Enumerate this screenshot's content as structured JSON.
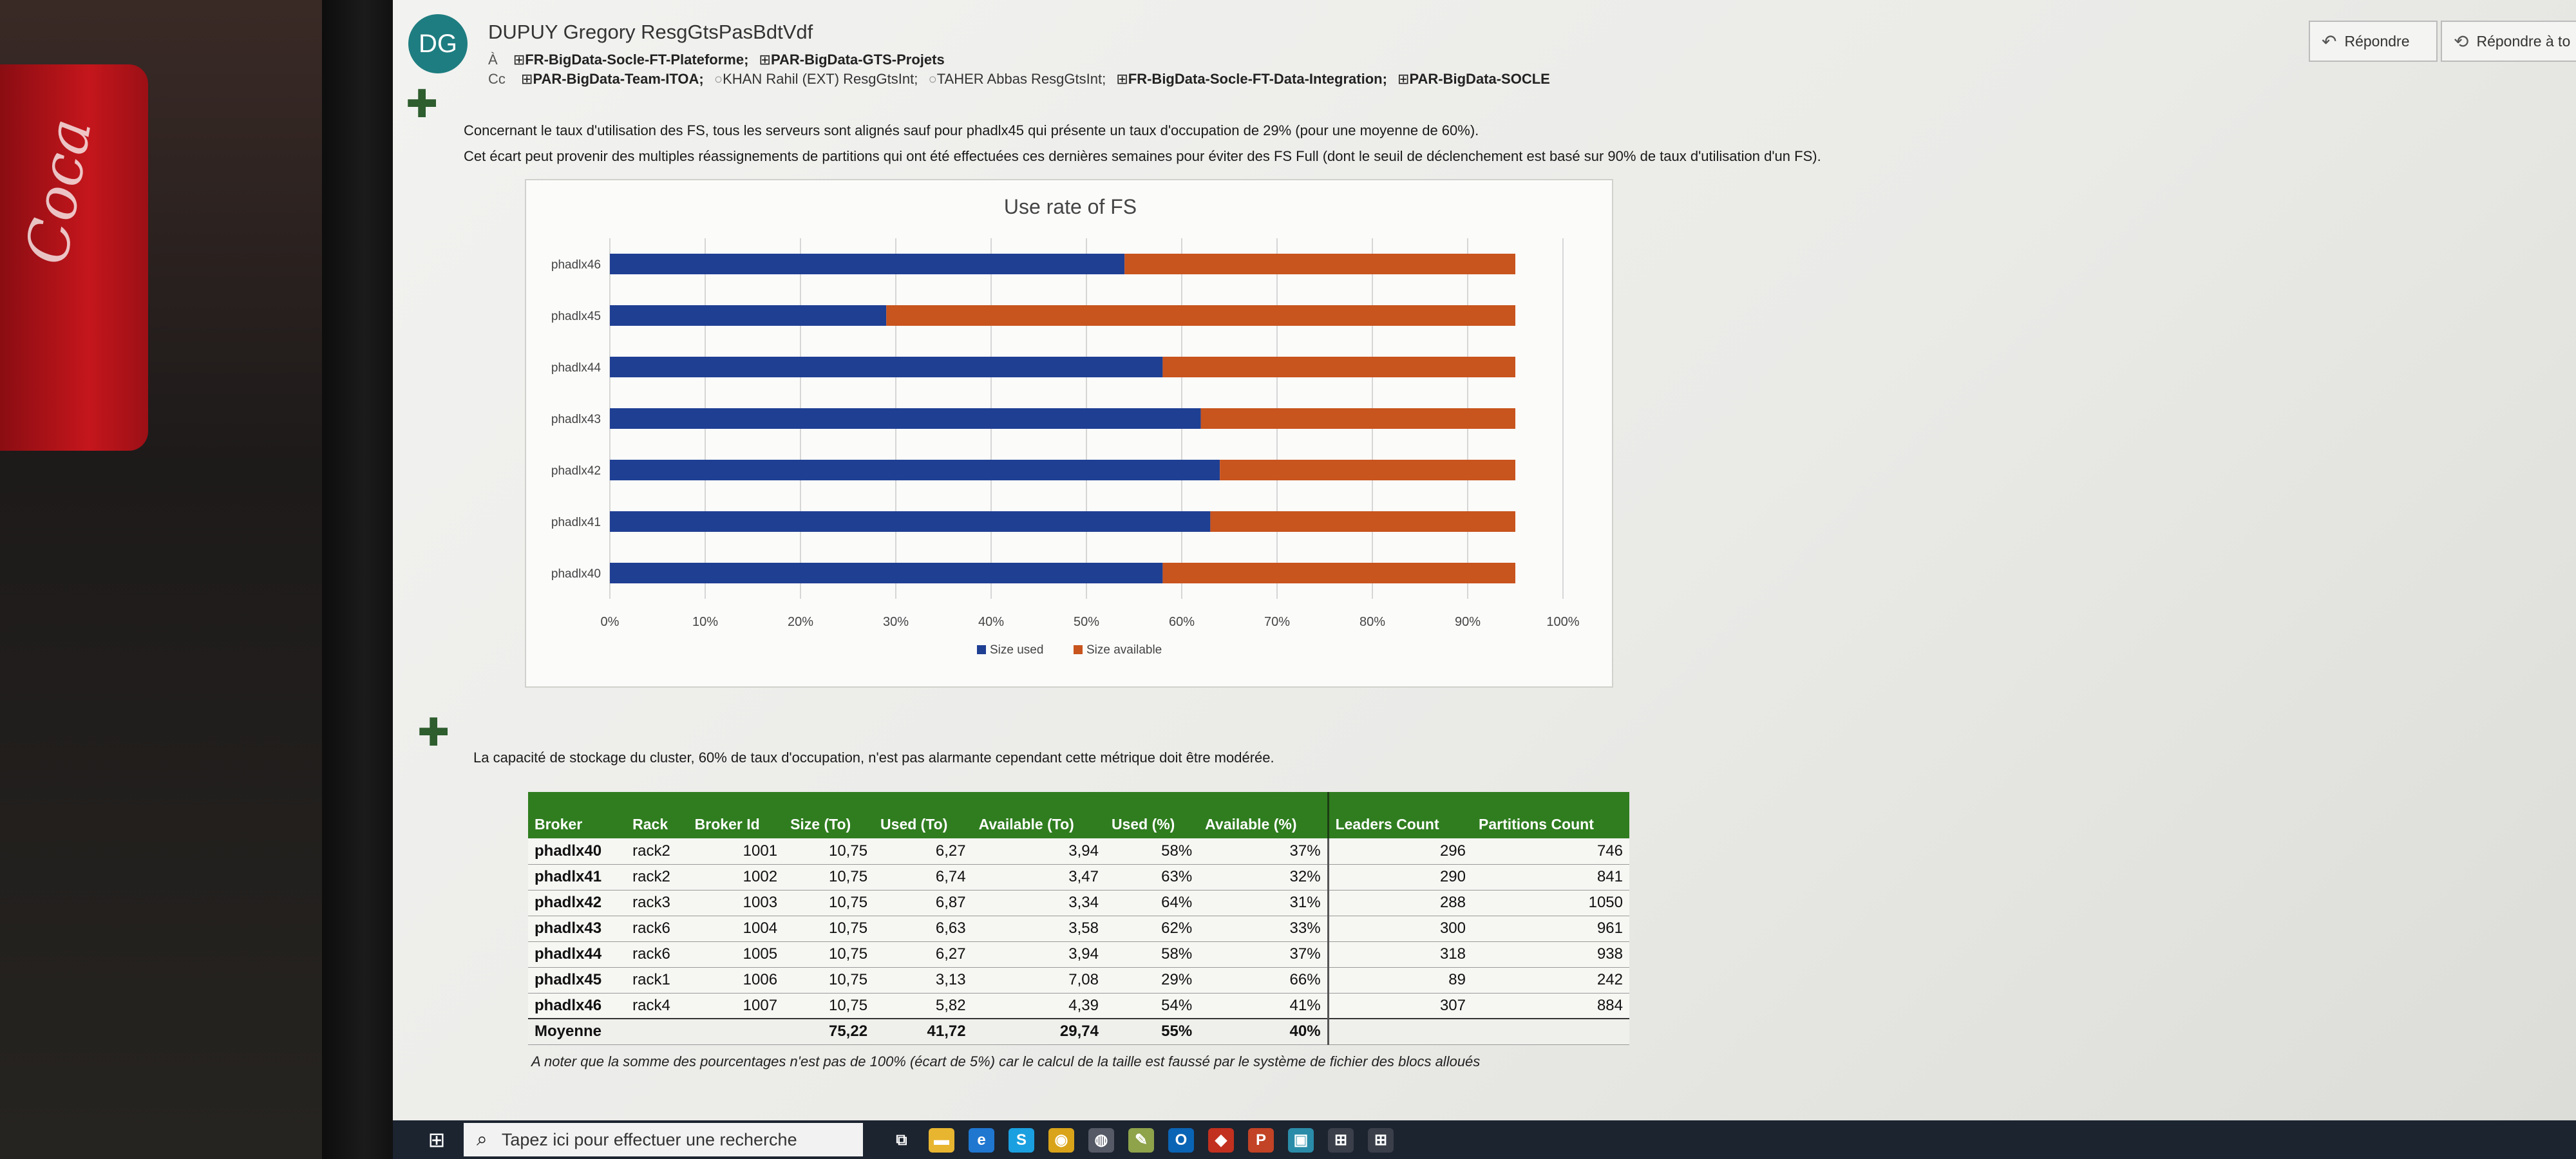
{
  "header": {
    "avatar_initials": "DG",
    "sender": "DUPUY Gregory ResgGtsPasBdtVdf",
    "to_label": "À",
    "to": [
      "FR-BigData-Socle-FT-Plateforme;",
      "PAR-BigData-GTS-Projets"
    ],
    "cc_label": "Cc",
    "cc_groups_1": [
      "PAR-BigData-Team-ITOA;"
    ],
    "cc_people": [
      "KHAN Rahil (EXT) ResgGtsInt;",
      "TAHER Abbas ResgGtsInt;"
    ],
    "cc_groups_2": [
      "FR-BigData-Socle-FT-Data-Integration;",
      "PAR-BigData-SOCLE"
    ],
    "reply_label": "Répondre",
    "reply_all_label": "Répondre à to"
  },
  "body": {
    "para1": "Concernant le taux d'utilisation des FS, tous les serveurs sont alignés sauf pour phadlx45 qui présente un taux d'occupation de 29% (pour une moyenne de 60%).",
    "para2": "Cet écart peut provenir des multiples réassignements de partitions qui ont été effectuées ces dernières semaines pour éviter des FS Full (dont le seuil de déclenchement est basé sur 90% de taux d'utilisation d'un FS).",
    "para3": "La capacité de stockage du cluster, 60% de taux d'occupation, n'est pas alarmante cependant cette métrique doit être modérée.",
    "note": "A noter que la somme des pourcentages n'est pas de 100% (écart de 5%) car le calcul de la taille est faussé par le système de fichier des blocs alloués"
  },
  "chart_data": {
    "type": "bar",
    "orientation": "horizontal",
    "stacked": true,
    "title": "Use rate of FS",
    "categories": [
      "phadlx46",
      "phadlx45",
      "phadlx44",
      "phadlx43",
      "phadlx42",
      "phadlx41",
      "phadlx40"
    ],
    "series": [
      {
        "name": "Size used",
        "color": "#1f3f93",
        "values": [
          54,
          29,
          58,
          62,
          64,
          63,
          58
        ]
      },
      {
        "name": "Size available",
        "color": "#c8541e",
        "values": [
          41,
          66,
          37,
          33,
          31,
          32,
          37
        ]
      }
    ],
    "xlim": [
      0,
      100
    ],
    "xticks": [
      "0%",
      "10%",
      "20%",
      "30%",
      "40%",
      "50%",
      "60%",
      "70%",
      "80%",
      "90%",
      "100%"
    ],
    "grid": true,
    "legend_position": "bottom"
  },
  "table": {
    "headers": [
      "Broker",
      "Rack",
      "Broker Id",
      "Size (To)",
      "Used (To)",
      "Available (To)",
      "Used (%)",
      "Available (%)",
      "Leaders Count",
      "Partitions Count"
    ],
    "rows": [
      [
        "phadlx40",
        "rack2",
        "1001",
        "10,75",
        "6,27",
        "3,94",
        "58%",
        "37%",
        "296",
        "746"
      ],
      [
        "phadlx41",
        "rack2",
        "1002",
        "10,75",
        "6,74",
        "3,47",
        "63%",
        "32%",
        "290",
        "841"
      ],
      [
        "phadlx42",
        "rack3",
        "1003",
        "10,75",
        "6,87",
        "3,34",
        "64%",
        "31%",
        "288",
        "1050"
      ],
      [
        "phadlx43",
        "rack6",
        "1004",
        "10,75",
        "6,63",
        "3,58",
        "62%",
        "33%",
        "300",
        "961"
      ],
      [
        "phadlx44",
        "rack6",
        "1005",
        "10,75",
        "6,27",
        "3,94",
        "58%",
        "37%",
        "318",
        "938"
      ],
      [
        "phadlx45",
        "rack1",
        "1006",
        "10,75",
        "3,13",
        "7,08",
        "29%",
        "66%",
        "89",
        "242"
      ],
      [
        "phadlx46",
        "rack4",
        "1007",
        "10,75",
        "5,82",
        "4,39",
        "54%",
        "41%",
        "307",
        "884"
      ]
    ],
    "average": [
      "Moyenne",
      "",
      "",
      "75,22",
      "41,72",
      "29,74",
      "55%",
      "40%",
      "",
      ""
    ]
  },
  "taskbar": {
    "search_placeholder": "Tapez ici pour effectuer une recherche",
    "icons": [
      {
        "name": "task-view-icon",
        "glyph": "⧉",
        "color": "#1c2430"
      },
      {
        "name": "file-explorer-icon",
        "glyph": "▬",
        "color": "#e8b530"
      },
      {
        "name": "edge-icon",
        "glyph": "e",
        "color": "#1f77d0"
      },
      {
        "name": "skype-icon",
        "glyph": "S",
        "color": "#1aa0e0"
      },
      {
        "name": "chrome-icon",
        "glyph": "◉",
        "color": "#d9a41a"
      },
      {
        "name": "lock-app-icon",
        "glyph": "◍",
        "color": "#555a66"
      },
      {
        "name": "notepad-icon",
        "glyph": "✎",
        "color": "#8ea34a"
      },
      {
        "name": "outlook-icon",
        "glyph": "O",
        "color": "#0a64b5"
      },
      {
        "name": "git-icon",
        "glyph": "◆",
        "color": "#c2301f"
      },
      {
        "name": "powerpoint-icon",
        "glyph": "P",
        "color": "#c24325"
      },
      {
        "name": "remote-app-icon",
        "glyph": "▣",
        "color": "#2a8ca8"
      },
      {
        "name": "remote-desktop-icon",
        "glyph": "⊞",
        "color": "#3a3f4a"
      },
      {
        "name": "network-app-icon",
        "glyph": "⊞",
        "color": "#3a3f4a"
      }
    ]
  },
  "colors": {
    "table_header": "#2f7d1f",
    "avatar": "#1e7d80"
  }
}
